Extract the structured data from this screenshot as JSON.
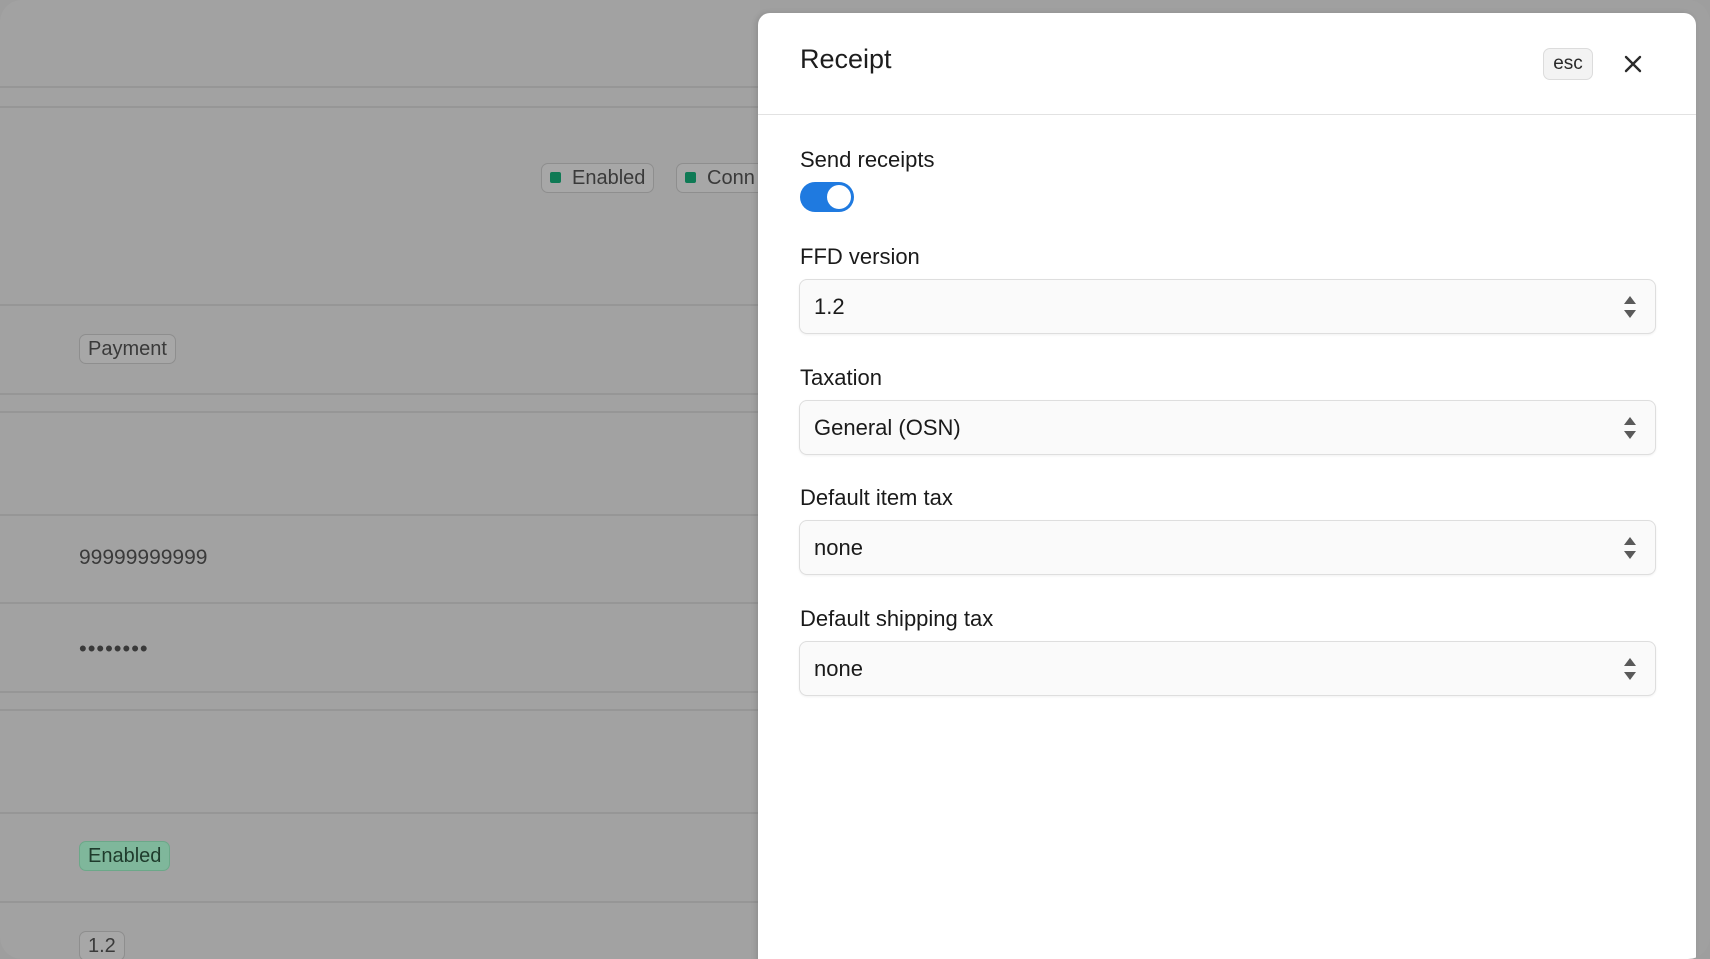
{
  "background": {
    "status_chip": "Enabled",
    "conn_chip": "Conn",
    "payment_chip": "Payment",
    "phone": "99999999999",
    "password_mask": "••••••••",
    "enabled_badge": "Enabled",
    "version_chip": "1.2"
  },
  "drawer": {
    "title": "Receipt",
    "esc_label": "esc",
    "close_icon": "close-icon"
  },
  "form": {
    "send_receipts_label": "Send receipts",
    "send_receipts_on": true,
    "ffd_label": "FFD version",
    "ffd_value": "1.2",
    "taxation_label": "Taxation",
    "taxation_value": "General (OSN)",
    "item_tax_label": "Default item tax",
    "item_tax_value": "none",
    "shipping_tax_label": "Default shipping tax",
    "shipping_tax_value": "none"
  },
  "colors": {
    "toggle_on": "#1f7ae0",
    "status_dot": "#0f7a55",
    "overlay": "#a0a0a0"
  }
}
